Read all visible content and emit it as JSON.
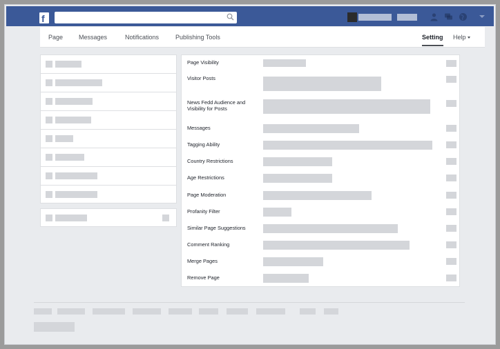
{
  "pagenav": {
    "items": [
      "Page",
      "Messages",
      "Notifications",
      "Publishing Tools"
    ],
    "active": "Setting",
    "help": "Help"
  },
  "settings": {
    "rows": [
      {
        "label": "Page Visibility"
      },
      {
        "label": "Visitor Posts"
      },
      {
        "label": "News Fedd Audience and Visibility for Posts"
      },
      {
        "label": "Messages"
      },
      {
        "label": "Tagging Ability"
      },
      {
        "label": "Country Restrictions"
      },
      {
        "label": "Age Restrictions"
      },
      {
        "label": "Page Moderation"
      },
      {
        "label": "Profanity Filter"
      },
      {
        "label": "Similar Page Suggestions"
      },
      {
        "label": "Comment Ranking"
      },
      {
        "label": "Merge Pages"
      },
      {
        "label": "Remove Page"
      }
    ]
  },
  "icons": [
    "facebook-logo-icon",
    "search-icon",
    "friend-requests-icon",
    "messages-icon",
    "notifications-globe-icon",
    "account-menu-caret-icon"
  ],
  "colors": {
    "brand": "#3b5998",
    "background": "#e9ebee",
    "placeholder": "#d4d6da"
  }
}
